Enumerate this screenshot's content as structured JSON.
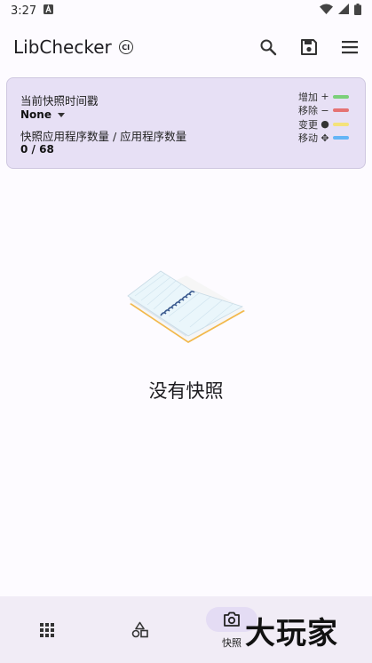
{
  "status_bar": {
    "time": "3:27"
  },
  "app_bar": {
    "title": "LibChecker",
    "badge": "CI"
  },
  "snapshot_card": {
    "timestamp_label": "当前快照时间戳",
    "timestamp_value": "None",
    "count_label": "快照应用程序数量 / 应用程序数量",
    "count_value": "0 / 68"
  },
  "legend": [
    {
      "label": "增加",
      "symbol": "+",
      "color": "#7bd07a"
    },
    {
      "label": "移除",
      "symbol": "−",
      "color": "#e57373"
    },
    {
      "label": "变更",
      "symbol": "●",
      "color": "#f4e27a"
    },
    {
      "label": "移动",
      "symbol": "✥",
      "color": "#64b5f6"
    }
  ],
  "empty_state": {
    "text": "没有快照"
  },
  "bottom_nav": {
    "snapshot_label": "快照"
  },
  "watermark": "大玩家"
}
